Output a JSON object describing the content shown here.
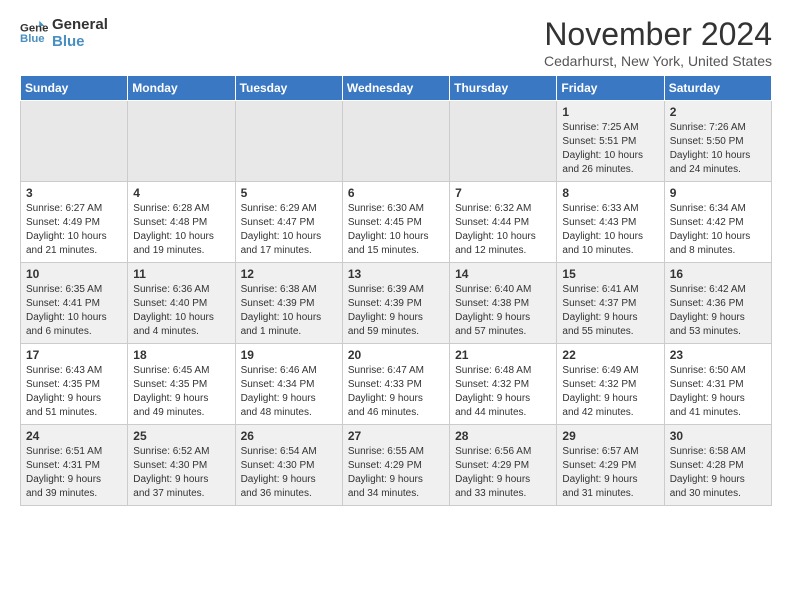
{
  "logo": {
    "line1": "General",
    "line2": "Blue"
  },
  "title": "November 2024",
  "location": "Cedarhurst, New York, United States",
  "weekdays": [
    "Sunday",
    "Monday",
    "Tuesday",
    "Wednesday",
    "Thursday",
    "Friday",
    "Saturday"
  ],
  "weeks": [
    [
      {
        "day": "",
        "info": ""
      },
      {
        "day": "",
        "info": ""
      },
      {
        "day": "",
        "info": ""
      },
      {
        "day": "",
        "info": ""
      },
      {
        "day": "",
        "info": ""
      },
      {
        "day": "1",
        "info": "Sunrise: 7:25 AM\nSunset: 5:51 PM\nDaylight: 10 hours\nand 26 minutes."
      },
      {
        "day": "2",
        "info": "Sunrise: 7:26 AM\nSunset: 5:50 PM\nDaylight: 10 hours\nand 24 minutes."
      }
    ],
    [
      {
        "day": "3",
        "info": "Sunrise: 6:27 AM\nSunset: 4:49 PM\nDaylight: 10 hours\nand 21 minutes."
      },
      {
        "day": "4",
        "info": "Sunrise: 6:28 AM\nSunset: 4:48 PM\nDaylight: 10 hours\nand 19 minutes."
      },
      {
        "day": "5",
        "info": "Sunrise: 6:29 AM\nSunset: 4:47 PM\nDaylight: 10 hours\nand 17 minutes."
      },
      {
        "day": "6",
        "info": "Sunrise: 6:30 AM\nSunset: 4:45 PM\nDaylight: 10 hours\nand 15 minutes."
      },
      {
        "day": "7",
        "info": "Sunrise: 6:32 AM\nSunset: 4:44 PM\nDaylight: 10 hours\nand 12 minutes."
      },
      {
        "day": "8",
        "info": "Sunrise: 6:33 AM\nSunset: 4:43 PM\nDaylight: 10 hours\nand 10 minutes."
      },
      {
        "day": "9",
        "info": "Sunrise: 6:34 AM\nSunset: 4:42 PM\nDaylight: 10 hours\nand 8 minutes."
      }
    ],
    [
      {
        "day": "10",
        "info": "Sunrise: 6:35 AM\nSunset: 4:41 PM\nDaylight: 10 hours\nand 6 minutes."
      },
      {
        "day": "11",
        "info": "Sunrise: 6:36 AM\nSunset: 4:40 PM\nDaylight: 10 hours\nand 4 minutes."
      },
      {
        "day": "12",
        "info": "Sunrise: 6:38 AM\nSunset: 4:39 PM\nDaylight: 10 hours\nand 1 minute."
      },
      {
        "day": "13",
        "info": "Sunrise: 6:39 AM\nSunset: 4:39 PM\nDaylight: 9 hours\nand 59 minutes."
      },
      {
        "day": "14",
        "info": "Sunrise: 6:40 AM\nSunset: 4:38 PM\nDaylight: 9 hours\nand 57 minutes."
      },
      {
        "day": "15",
        "info": "Sunrise: 6:41 AM\nSunset: 4:37 PM\nDaylight: 9 hours\nand 55 minutes."
      },
      {
        "day": "16",
        "info": "Sunrise: 6:42 AM\nSunset: 4:36 PM\nDaylight: 9 hours\nand 53 minutes."
      }
    ],
    [
      {
        "day": "17",
        "info": "Sunrise: 6:43 AM\nSunset: 4:35 PM\nDaylight: 9 hours\nand 51 minutes."
      },
      {
        "day": "18",
        "info": "Sunrise: 6:45 AM\nSunset: 4:35 PM\nDaylight: 9 hours\nand 49 minutes."
      },
      {
        "day": "19",
        "info": "Sunrise: 6:46 AM\nSunset: 4:34 PM\nDaylight: 9 hours\nand 48 minutes."
      },
      {
        "day": "20",
        "info": "Sunrise: 6:47 AM\nSunset: 4:33 PM\nDaylight: 9 hours\nand 46 minutes."
      },
      {
        "day": "21",
        "info": "Sunrise: 6:48 AM\nSunset: 4:32 PM\nDaylight: 9 hours\nand 44 minutes."
      },
      {
        "day": "22",
        "info": "Sunrise: 6:49 AM\nSunset: 4:32 PM\nDaylight: 9 hours\nand 42 minutes."
      },
      {
        "day": "23",
        "info": "Sunrise: 6:50 AM\nSunset: 4:31 PM\nDaylight: 9 hours\nand 41 minutes."
      }
    ],
    [
      {
        "day": "24",
        "info": "Sunrise: 6:51 AM\nSunset: 4:31 PM\nDaylight: 9 hours\nand 39 minutes."
      },
      {
        "day": "25",
        "info": "Sunrise: 6:52 AM\nSunset: 4:30 PM\nDaylight: 9 hours\nand 37 minutes."
      },
      {
        "day": "26",
        "info": "Sunrise: 6:54 AM\nSunset: 4:30 PM\nDaylight: 9 hours\nand 36 minutes."
      },
      {
        "day": "27",
        "info": "Sunrise: 6:55 AM\nSunset: 4:29 PM\nDaylight: 9 hours\nand 34 minutes."
      },
      {
        "day": "28",
        "info": "Sunrise: 6:56 AM\nSunset: 4:29 PM\nDaylight: 9 hours\nand 33 minutes."
      },
      {
        "day": "29",
        "info": "Sunrise: 6:57 AM\nSunset: 4:29 PM\nDaylight: 9 hours\nand 31 minutes."
      },
      {
        "day": "30",
        "info": "Sunrise: 6:58 AM\nSunset: 4:28 PM\nDaylight: 9 hours\nand 30 minutes."
      }
    ]
  ]
}
